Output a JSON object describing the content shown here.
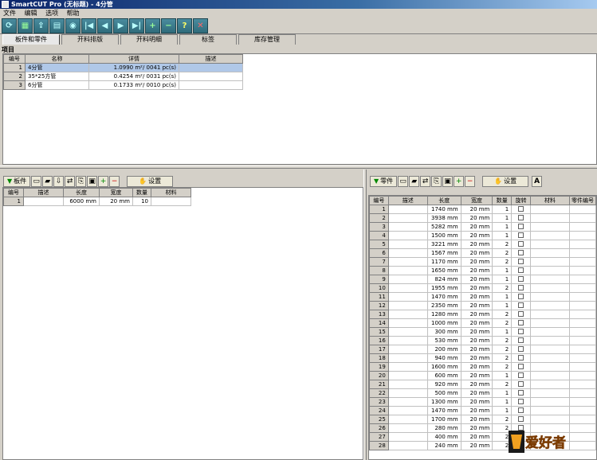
{
  "window": {
    "title": "SmartCUT Pro (无标题) - 4分管"
  },
  "menu": [
    "文件",
    "编辑",
    "选项",
    "帮助"
  ],
  "toolbar_icons": [
    "refresh-icon",
    "grid-icon",
    "export-icon",
    "print-icon",
    "preview-icon",
    "first-icon",
    "prev-icon",
    "next-icon",
    "last-icon",
    "add-icon",
    "remove-icon",
    "help-icon",
    "close-icon"
  ],
  "tabs": [
    "板件和零件",
    "开料排版",
    "开料明细",
    "标签",
    "库存管理"
  ],
  "projects": {
    "title": "项目",
    "columns": [
      "编号",
      "名称",
      "详情",
      "描述"
    ],
    "rows": [
      {
        "id": "1",
        "name": "4分管",
        "detail": "1.0990 m²/ 0041 pc(s)",
        "desc": ""
      },
      {
        "id": "2",
        "name": "35*25方管",
        "detail": "0.4254 m²/ 0031 pc(s)",
        "desc": ""
      },
      {
        "id": "3",
        "name": "6分管",
        "detail": "0.1733 m²/ 0010 pc(s)",
        "desc": ""
      }
    ]
  },
  "boards": {
    "add_label": "板件",
    "settings_label": "设置",
    "columns": [
      "编号",
      "描述",
      "长度",
      "宽度",
      "数量",
      "材料"
    ],
    "rows": [
      {
        "id": "1",
        "desc": "",
        "length": "6000 mm",
        "width": "20 mm",
        "qty": "10",
        "material": ""
      }
    ]
  },
  "parts": {
    "add_label": "零件",
    "settings_label": "设置",
    "columns": [
      "编号",
      "描述",
      "长度",
      "宽度",
      "数量",
      "旋转",
      "材料",
      "零件编号"
    ],
    "rows": [
      {
        "id": "1",
        "length": "1740 mm",
        "width": "20 mm",
        "qty": "1"
      },
      {
        "id": "2",
        "length": "3938 mm",
        "width": "20 mm",
        "qty": "1"
      },
      {
        "id": "3",
        "length": "5282 mm",
        "width": "20 mm",
        "qty": "1"
      },
      {
        "id": "4",
        "length": "1500 mm",
        "width": "20 mm",
        "qty": "1"
      },
      {
        "id": "5",
        "length": "3221 mm",
        "width": "20 mm",
        "qty": "2"
      },
      {
        "id": "6",
        "length": "1567 mm",
        "width": "20 mm",
        "qty": "2"
      },
      {
        "id": "7",
        "length": "1170 mm",
        "width": "20 mm",
        "qty": "2"
      },
      {
        "id": "8",
        "length": "1650 mm",
        "width": "20 mm",
        "qty": "1"
      },
      {
        "id": "9",
        "length": "824 mm",
        "width": "20 mm",
        "qty": "1"
      },
      {
        "id": "10",
        "length": "1955 mm",
        "width": "20 mm",
        "qty": "2"
      },
      {
        "id": "11",
        "length": "1470 mm",
        "width": "20 mm",
        "qty": "1"
      },
      {
        "id": "12",
        "length": "2350 mm",
        "width": "20 mm",
        "qty": "1"
      },
      {
        "id": "13",
        "length": "1280 mm",
        "width": "20 mm",
        "qty": "2"
      },
      {
        "id": "14",
        "length": "1000 mm",
        "width": "20 mm",
        "qty": "2"
      },
      {
        "id": "15",
        "length": "300 mm",
        "width": "20 mm",
        "qty": "1"
      },
      {
        "id": "16",
        "length": "530 mm",
        "width": "20 mm",
        "qty": "2"
      },
      {
        "id": "17",
        "length": "200 mm",
        "width": "20 mm",
        "qty": "2"
      },
      {
        "id": "18",
        "length": "940 mm",
        "width": "20 mm",
        "qty": "2"
      },
      {
        "id": "19",
        "length": "1600 mm",
        "width": "20 mm",
        "qty": "2"
      },
      {
        "id": "20",
        "length": "600 mm",
        "width": "20 mm",
        "qty": "1"
      },
      {
        "id": "21",
        "length": "920 mm",
        "width": "20 mm",
        "qty": "2"
      },
      {
        "id": "22",
        "length": "500 mm",
        "width": "20 mm",
        "qty": "1"
      },
      {
        "id": "23",
        "length": "1300 mm",
        "width": "20 mm",
        "qty": "1"
      },
      {
        "id": "24",
        "length": "1470 mm",
        "width": "20 mm",
        "qty": "1"
      },
      {
        "id": "25",
        "length": "1700 mm",
        "width": "20 mm",
        "qty": "2"
      },
      {
        "id": "26",
        "length": "280 mm",
        "width": "20 mm",
        "qty": "2"
      },
      {
        "id": "27",
        "length": "400 mm",
        "width": "20 mm",
        "qty": "2"
      },
      {
        "id": "28",
        "length": "240 mm",
        "width": "20 mm",
        "qty": "2"
      }
    ]
  },
  "logo": {
    "text": "爱好者"
  },
  "colors": {
    "selection": "#b0c8e8",
    "title_start": "#0a246a",
    "toolbar_btn": "#2f6b7b"
  }
}
